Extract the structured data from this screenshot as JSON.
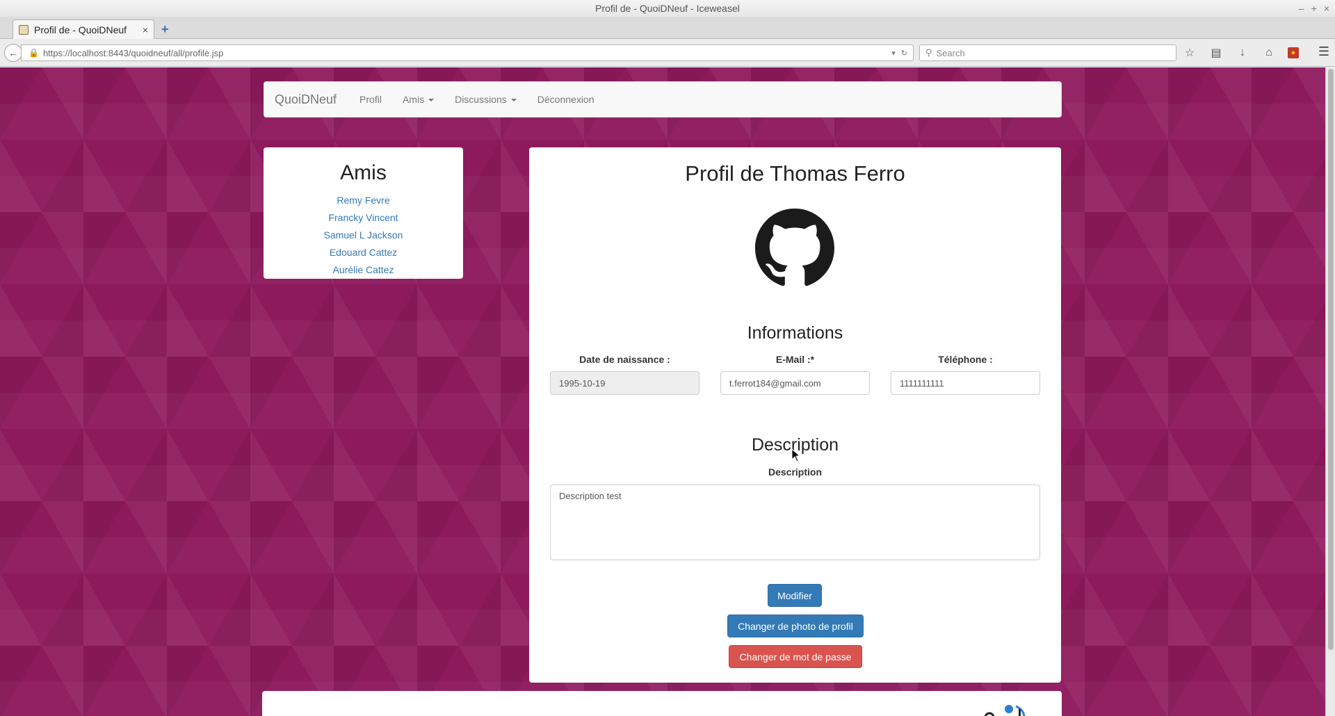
{
  "window": {
    "title": "Profil de - QuoiDNeuf - Iceweasel"
  },
  "tab": {
    "title": "Profil de - QuoiDNeuf",
    "close": "×",
    "new_tab": "+"
  },
  "urlbar": {
    "url": "https://localhost:8443/quoidneuf/all/profile.jsp"
  },
  "searchbar": {
    "placeholder": "Search"
  },
  "toolbar_icons": [
    "bookmark-star-icon",
    "reading-list-icon",
    "download-icon",
    "home-icon",
    "extension-icon",
    "menu-icon"
  ],
  "app_nav": {
    "brand": "QuoiDNeuf",
    "links": [
      "Profil",
      "Amis",
      "Discussions",
      "Déconnexion"
    ]
  },
  "friends": {
    "heading": "Amis",
    "items": [
      "Remy Fevre",
      "Francky Vincent",
      "Samuel L Jackson",
      "Edouard Cattez",
      "Aurélie Cattez"
    ]
  },
  "profile": {
    "title": "Profil de Thomas Ferro",
    "avatar_icon": "github-octocat-icon",
    "info_heading": "Informations",
    "fields": {
      "birthdate": {
        "label": "Date de naissance :",
        "value": "1995-10-19"
      },
      "email": {
        "label": "E-Mail :*",
        "value": "t.ferrot184@gmail.com"
      },
      "phone": {
        "label": "Téléphone :",
        "value": "1111111111"
      }
    },
    "description_heading": "Description",
    "description_label": "Description",
    "description_value": "Description test",
    "buttons": {
      "modify": "Modifier",
      "change_photo": "Changer de photo de profil",
      "change_password": "Changer de mot de passe"
    }
  },
  "colors": {
    "background": "#8e1a5e",
    "primary": "#337ab7",
    "danger": "#d9534f",
    "link": "#337ab7"
  }
}
